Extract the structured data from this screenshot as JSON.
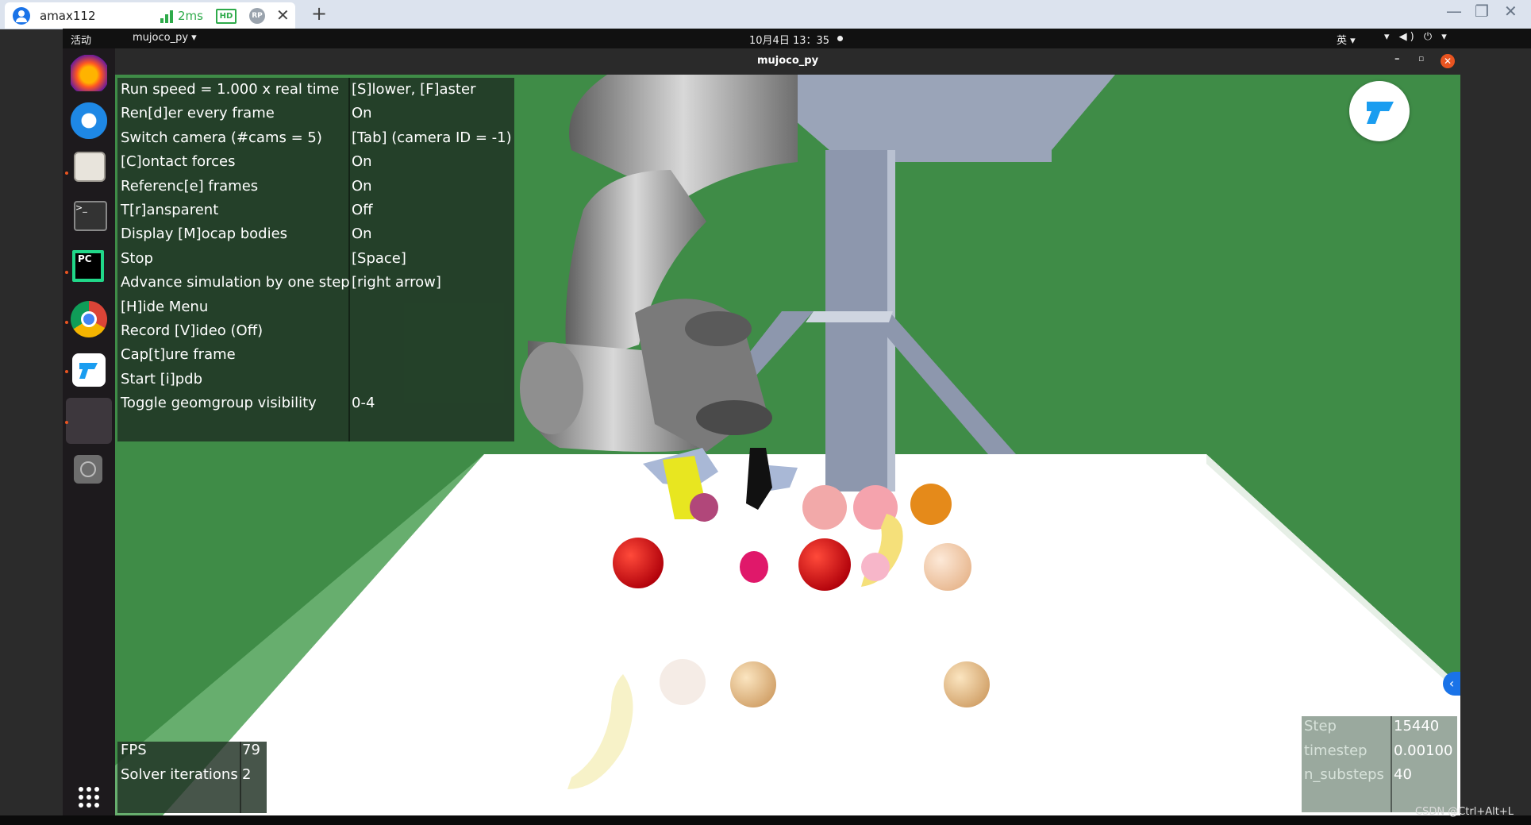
{
  "remote_tab": {
    "title": "amax112",
    "latency": "2ms",
    "hd_badge": "HD",
    "rp_badge": "RP",
    "close": "✕",
    "new_tab": "+"
  },
  "window_controls": {
    "minimize": "—",
    "restore": "❐",
    "close": "✕"
  },
  "topbar": {
    "activities": "活动",
    "app_menu": "mujoco_py ▾",
    "clock": "10月4日 13：35",
    "input_method": "英 ▾",
    "tray": "▾ ◀) ⏻ ▾"
  },
  "dock": {
    "items": [
      "firefox-icon",
      "thunderbird-icon",
      "files-icon",
      "terminal-icon",
      "pycharm-icon",
      "chrome-icon",
      "remote-desktop-icon",
      "active-window-icon",
      "disc-icon",
      "app-grid-icon"
    ]
  },
  "app_window": {
    "title": "mujoco_py",
    "minimize": "–",
    "maximize": "▫",
    "close": "✕"
  },
  "menu": {
    "keys": [
      "Run speed = 1.000 x real time",
      "Ren[d]er every frame",
      "Switch camera (#cams = 5)",
      "[C]ontact forces",
      "Referenc[e] frames",
      "T[r]ansparent",
      "Display [M]ocap bodies",
      "Stop",
      "Advance simulation by one step",
      "[H]ide Menu",
      "Record [V]ideo (Off)",
      "Cap[t]ure frame",
      "Start [i]pdb",
      "Toggle geomgroup visibility"
    ],
    "values": [
      "[S]lower, [F]aster",
      "On",
      "[Tab] (camera ID = -1)",
      "On",
      "On",
      "Off",
      "On",
      "[Space]",
      "[right arrow]",
      "",
      "",
      "",
      "",
      "0-4"
    ]
  },
  "fps_panel": {
    "keys": [
      "FPS",
      "Solver iterations"
    ],
    "values": [
      "79",
      "2"
    ]
  },
  "step_panel": {
    "keys": [
      "Step",
      "timestep",
      "n_substeps"
    ],
    "values": [
      "15440",
      "0.00100",
      "40"
    ]
  },
  "watermark": "CSDN @Ctrl+Alt+L",
  "side_toggle": "‹",
  "colors": {
    "floor": "#3f8c47",
    "table": "#ffffff",
    "robot": "#8c8c8c",
    "accent": "#e95420"
  }
}
